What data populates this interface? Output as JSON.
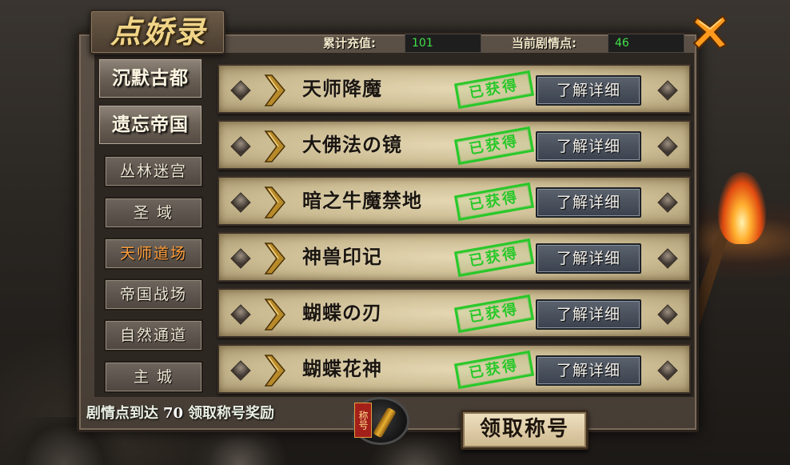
{
  "window": {
    "title": "点娇录"
  },
  "stats": {
    "recharge_label": "累计充值:",
    "recharge_value": "101",
    "story_label": "当前剧情点:",
    "story_value": "46"
  },
  "sidebar": {
    "categories": [
      {
        "label": "沉默古都"
      },
      {
        "label": "遗忘帝国"
      }
    ],
    "items": [
      {
        "label": "丛林迷宫",
        "active": false
      },
      {
        "label": "圣  域",
        "active": false
      },
      {
        "label": "天师道场",
        "active": true
      },
      {
        "label": "帝国战场",
        "active": false
      },
      {
        "label": "自然通道",
        "active": false
      },
      {
        "label": "主  城",
        "active": false
      }
    ]
  },
  "rows": [
    {
      "name": "天师降魔",
      "status": "已获得",
      "action": "了解详细"
    },
    {
      "name": "大佛法の镜",
      "status": "已获得",
      "action": "了解详细"
    },
    {
      "name": "暗之牛魔禁地",
      "status": "已获得",
      "action": "了解详细"
    },
    {
      "name": "神兽印记",
      "status": "已获得",
      "action": "了解详细"
    },
    {
      "name": "蝴蝶の刃",
      "status": "已获得",
      "action": "了解详细"
    },
    {
      "name": "蝴蝶花神",
      "status": "已获得",
      "action": "了解详细"
    }
  ],
  "footer": {
    "prefix": "剧情点到达",
    "threshold": "70",
    "suffix": "领取称号奖励",
    "medal_tag": "称号",
    "claim_label": "领取称号"
  },
  "colors": {
    "value_green": "#3fe04a",
    "stamp_green": "#28c829",
    "active_orange": "#ff9d3b",
    "close_orange": "#ff9a1e"
  },
  "icons": [
    "close-icon",
    "chevron-icon",
    "diamond-stud-icon",
    "title-medal-icon"
  ]
}
